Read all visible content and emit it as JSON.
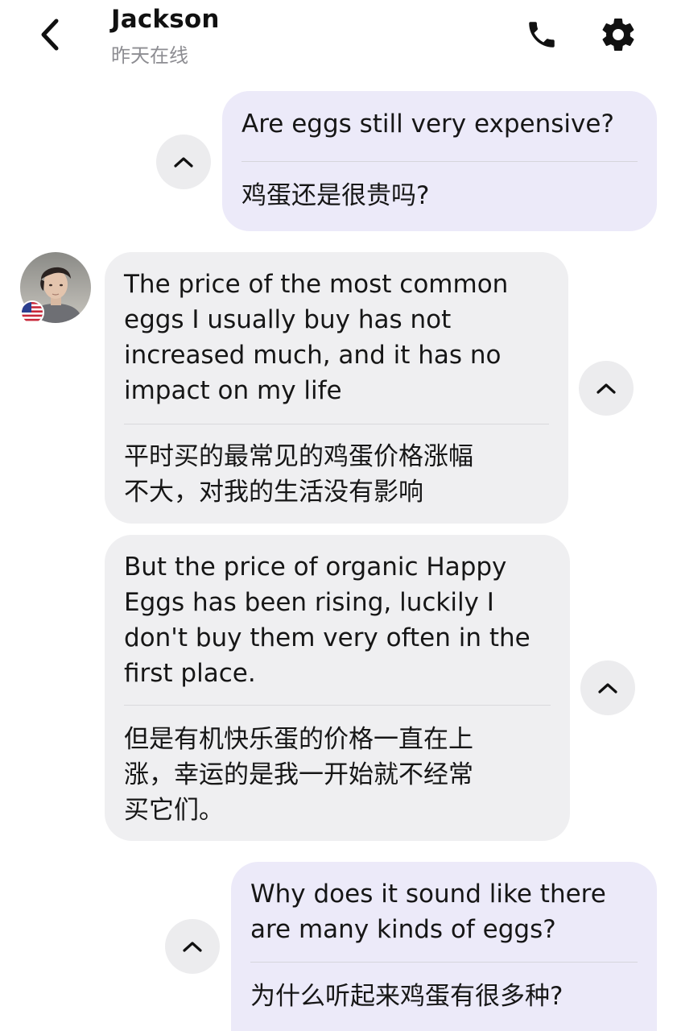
{
  "header": {
    "contact_name": "Jackson",
    "status": "昨天在线",
    "icons": {
      "back": "chevron-left-icon",
      "call": "phone-icon",
      "settings": "gear-icon"
    }
  },
  "colors": {
    "outgoing_bubble": "#eceaf9",
    "incoming_bubble": "#efeff1",
    "status_text": "#8d8d92",
    "toggle_button": "#ececee"
  },
  "messages": [
    {
      "direction": "outgoing",
      "original": "Are eggs still very expensive?",
      "translation": "鸡蛋还是很贵吗?",
      "toggle_icon": "chevron-up-icon"
    },
    {
      "direction": "incoming",
      "original": "The price of the most common\neggs I usually buy has not\nincreased much, and it has no\nimpact on my life",
      "translation": "平时买的最常见的鸡蛋价格涨幅\n不大，对我的生活没有影响",
      "toggle_icon": "chevron-up-icon"
    },
    {
      "direction": "incoming",
      "original": "But the price of organic Happy\nEggs has been rising, luckily I\ndon't buy them very often in the\nfirst place.",
      "translation": "但是有机快乐蛋的价格一直在上\n涨，幸运的是我一开始就不经常\n买它们。",
      "toggle_icon": "chevron-up-icon"
    },
    {
      "direction": "outgoing",
      "original": "Why does it sound like there\nare many kinds of eggs?",
      "translation": "为什么听起来鸡蛋有很多种?",
      "toggle_icon": "chevron-up-icon"
    }
  ],
  "avatar": {
    "icon": "avatar-photo",
    "flag_icon": "us-flag-icon"
  }
}
